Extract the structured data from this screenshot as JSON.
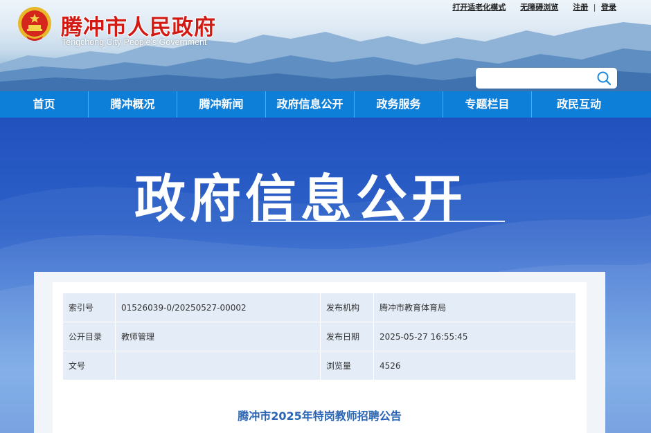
{
  "header": {
    "title": "腾冲市人民政府",
    "subtitle": "Tengchong City People's Government",
    "top_links": [
      "打开适老化模式",
      "无障碍浏览"
    ],
    "register": "注册",
    "login": "登录",
    "separator": "|",
    "search": {
      "placeholder": ""
    }
  },
  "nav": {
    "items": [
      "首页",
      "腾冲概况",
      "腾冲新闻",
      "政府信息公开",
      "政务服务",
      "专题栏目",
      "政民互动"
    ]
  },
  "banner": {
    "title": "政府信息公开"
  },
  "meta": {
    "rows": [
      {
        "k1": "索引号",
        "v1": "01526039-0/20250527-00002",
        "k2": "发布机构",
        "v2": "腾冲市教育体育局"
      },
      {
        "k1": "公开目录",
        "v1": "教师管理",
        "k2": "发布日期",
        "v2": "2025-05-27 16:55:45"
      },
      {
        "k1": "文号",
        "v1": "",
        "k2": "浏览量",
        "v2": "4526"
      }
    ]
  },
  "document": {
    "title": "腾冲市2025年特岗教师招聘公告"
  },
  "colors": {
    "nav": "#0e7fd9",
    "title_red": "#d21a14",
    "doc_title": "#2a64b5",
    "banner": "#2d61c9"
  }
}
